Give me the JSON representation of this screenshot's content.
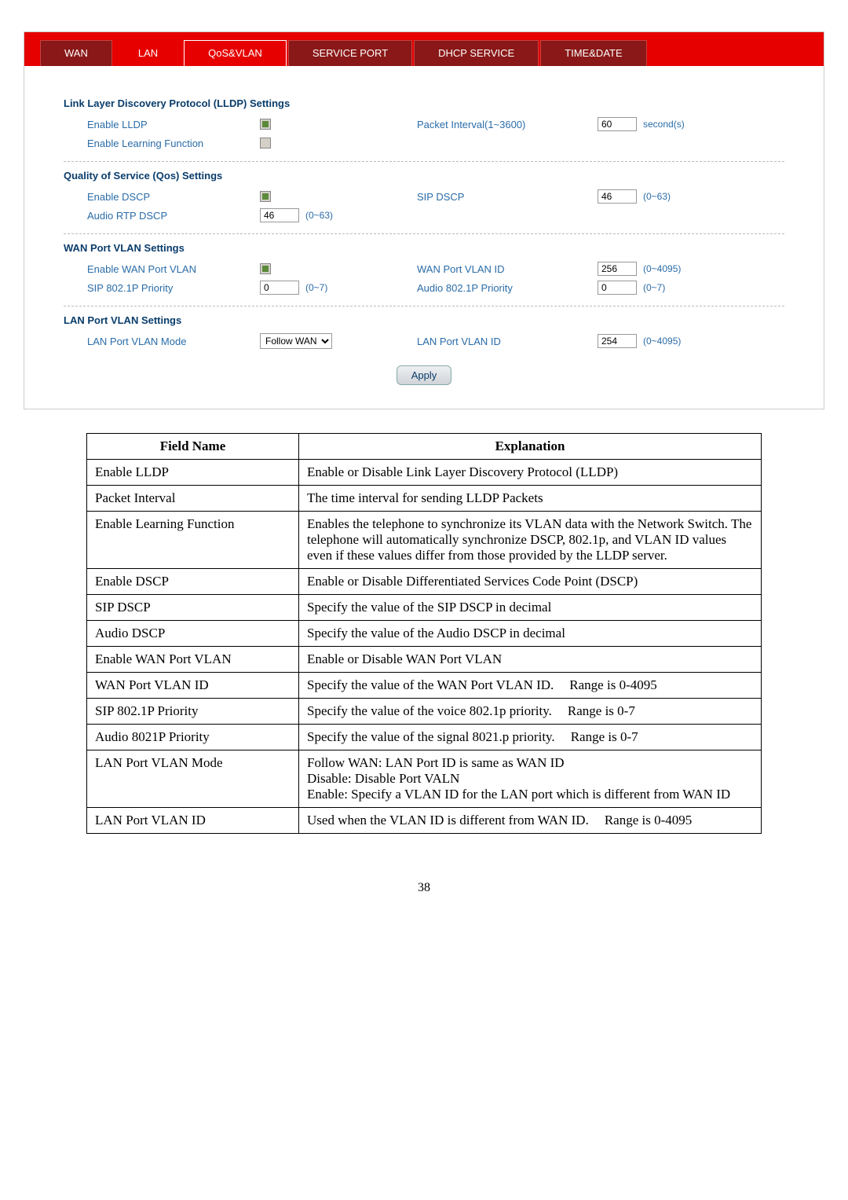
{
  "tabs": {
    "wan": "WAN",
    "lan": "LAN",
    "qosvlan": "QoS&VLAN",
    "serviceport": "SERVICE PORT",
    "dhcpservice": "DHCP SERVICE",
    "timedate": "TIME&DATE"
  },
  "sections": {
    "lldp_title": "Link Layer Discovery Protocol (LLDP) Settings",
    "qos_title": "Quality of Service (Qos) Settings",
    "wanvlan_title": "WAN Port VLAN Settings",
    "lanvlan_title": "LAN Port VLAN Settings"
  },
  "labels": {
    "enable_lldp": "Enable LLDP",
    "packet_interval": "Packet Interval(1~3600)",
    "packet_interval_unit": "second(s)",
    "enable_learning": "Enable Learning Function",
    "enable_dscp": "Enable DSCP",
    "sip_dscp": "SIP DSCP",
    "audio_rtp_dscp": "Audio RTP DSCP",
    "enable_wan_vlan": "Enable WAN Port VLAN",
    "wan_port_vlanid": "WAN Port VLAN ID",
    "sip_8021p": "SIP 802.1P Priority",
    "audio_8021p": "Audio 802.1P Priority",
    "lan_vlan_mode": "LAN Port VLAN Mode",
    "lan_port_vlanid": "LAN Port VLAN ID",
    "range_063": "(0~63)",
    "range_07": "(0~7)",
    "range_04095": "(0~4095)",
    "follow_wan_opt": "Follow WAN",
    "apply": "Apply"
  },
  "values": {
    "packet_interval": "60",
    "sip_dscp": "46",
    "audio_rtp_dscp": "46",
    "wan_port_vlanid": "256",
    "sip_8021p": "0",
    "audio_8021p": "0",
    "lan_port_vlanid": "254"
  },
  "table": {
    "header_field": "Field Name",
    "header_expl": "Explanation",
    "rows": [
      {
        "f": "Enable LLDP",
        "e": "Enable or Disable Link Layer Discovery Protocol (LLDP)"
      },
      {
        "f": "Packet Interval",
        "e": "The time interval for sending LLDP Packets"
      },
      {
        "f": "Enable Learning Function",
        "e": "Enables the telephone to synchronize its VLAN data with the Network Switch. The telephone will automatically synchronize DSCP, 802.1p, and VLAN ID values even if these values differ from those provided by the LLDP server."
      },
      {
        "f": "Enable DSCP",
        "e": "Enable or Disable Differentiated Services Code Point (DSCP)"
      },
      {
        "f": "SIP DSCP",
        "e": "Specify the value of the SIP DSCP in decimal"
      },
      {
        "f": "Audio DSCP",
        "e": "Specify the value of the Audio DSCP in decimal"
      },
      {
        "f": "Enable WAN Port VLAN",
        "e": "Enable or Disable WAN Port VLAN"
      },
      {
        "f": "WAN Port VLAN ID",
        "e": "Specify the value of the WAN Port VLAN ID.    Range is 0-4095"
      },
      {
        "f": "SIP 802.1P Priority",
        "e": "Specify the value of the voice 802.1p priority.    Range is 0-7"
      },
      {
        "f": "Audio 8021P Priority",
        "e": "Specify the value of the signal 8021.p priority.    Range is 0-7"
      },
      {
        "f": "LAN Port VLAN Mode",
        "e": "Follow WAN: LAN Port ID is same as WAN ID\nDisable: Disable Port VALN\nEnable: Specify a VLAN ID for the LAN port which is different from WAN ID"
      },
      {
        "f": "LAN Port VLAN ID",
        "e": "Used when the VLAN ID is different from WAN ID.    Range is 0-4095"
      }
    ]
  },
  "page_number": "38"
}
